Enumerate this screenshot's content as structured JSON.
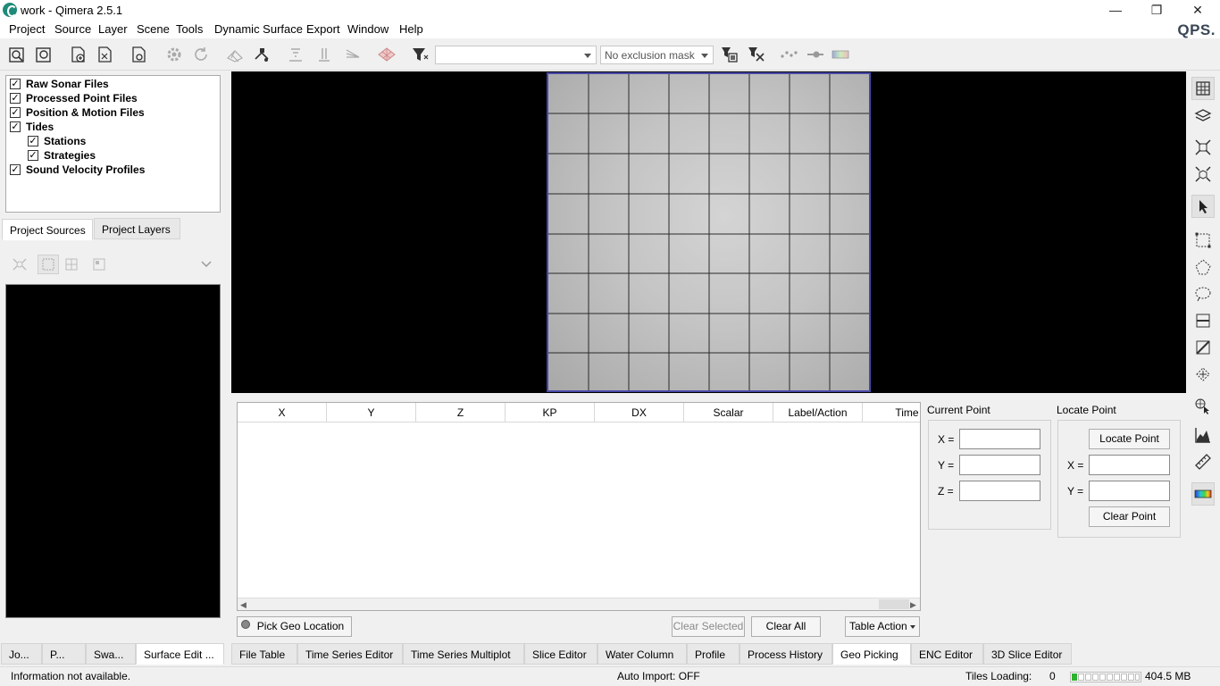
{
  "window": {
    "title": "work - Qimera 2.5.1",
    "minimize": "—",
    "restore": "❐",
    "close": "✕"
  },
  "menu": [
    {
      "label": "Project"
    },
    {
      "label": "Source"
    },
    {
      "label": "Layer"
    },
    {
      "label": "Scene"
    },
    {
      "label": "Tools"
    },
    {
      "label": "Dynamic Surface"
    },
    {
      "label": "Export"
    },
    {
      "label": "Window"
    },
    {
      "label": "Help"
    }
  ],
  "brand": "QPS.",
  "toolbar": {
    "combo1_value": "",
    "exclusion_mask": "No exclusion mask"
  },
  "tree": [
    {
      "label": "Raw Sonar Files",
      "checked": true,
      "indent": 0
    },
    {
      "label": "Processed Point Files",
      "checked": true,
      "indent": 0
    },
    {
      "label": "Position & Motion Files",
      "checked": true,
      "indent": 0
    },
    {
      "label": "Tides",
      "checked": true,
      "indent": 0
    },
    {
      "label": "Stations",
      "checked": true,
      "indent": 1
    },
    {
      "label": "Strategies",
      "checked": true,
      "indent": 1
    },
    {
      "label": "Sound Velocity Profiles",
      "checked": true,
      "indent": 0
    }
  ],
  "left_tabs": [
    "Project Sources",
    "Project Layers"
  ],
  "table": {
    "columns": [
      "X",
      "Y",
      "Z",
      "KP",
      "DX",
      "Scalar",
      "Label/Action",
      "Time"
    ]
  },
  "table_buttons": {
    "pick_geo": "Pick Geo Location",
    "clear_selected": "Clear Selected",
    "clear_all": "Clear All",
    "table_action": "Table Action"
  },
  "current_point": {
    "title": "Current Point",
    "x": "X =",
    "y": "Y =",
    "z": "Z ="
  },
  "locate_point": {
    "title": "Locate Point",
    "locate_btn": "Locate Point",
    "x": "X =",
    "y": "Y =",
    "clear_btn": "Clear Point"
  },
  "left_bottom_tabs": [
    "Jo...",
    "P...",
    "Swa...",
    "Surface Edit ..."
  ],
  "bottom_tabs": [
    "File Table",
    "Time Series Editor",
    "Time Series Multiplot",
    "Slice Editor",
    "Water Column",
    "Profile",
    "Process History",
    "Geo Picking",
    "ENC Editor",
    "3D Slice Editor"
  ],
  "status": {
    "info": "Information not available.",
    "auto_import": "Auto Import: OFF",
    "tiles_loading_label": "Tiles Loading:",
    "tiles_loading_count": "0",
    "memory": "404.5 MB"
  },
  "colors": {
    "surface_border": "#4848a8",
    "progress": "#2db22d"
  }
}
